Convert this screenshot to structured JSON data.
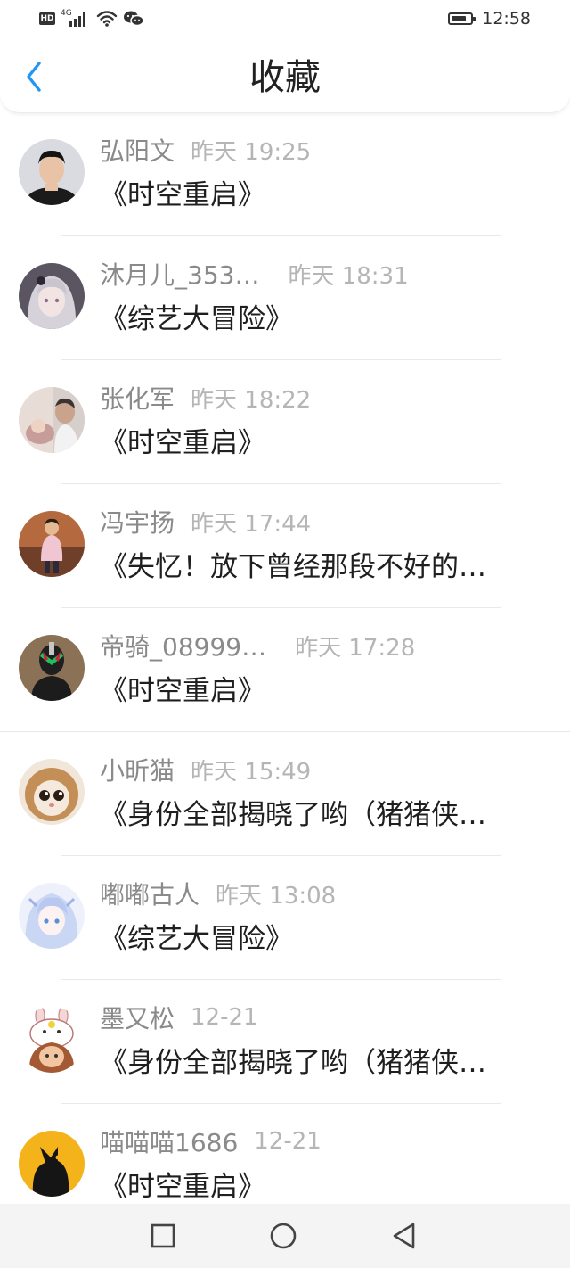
{
  "status_bar": {
    "hd_label": "HD",
    "network_label": "4G",
    "time": "12:58",
    "battery_level": 0.8,
    "icons": [
      "hd-icon",
      "signal-icon",
      "wifi-icon",
      "wechat-icon",
      "battery-icon"
    ]
  },
  "header": {
    "title": "收藏",
    "back_icon": "chevron-left-icon",
    "accent_color": "#2196f3"
  },
  "items": [
    {
      "name": "弘阳文",
      "time": "昨天 19:25",
      "title": "《时空重启》"
    },
    {
      "name": "沐月儿_353…",
      "time": "昨天 18:31",
      "title": "《综艺大冒险》"
    },
    {
      "name": "张化军",
      "time": "昨天 18:22",
      "title": "《时空重启》"
    },
    {
      "name": "冯宇扬",
      "time": "昨天 17:44",
      "title": "《失忆！放下曾经那段不好的…"
    },
    {
      "name": "帝骑_08999…",
      "time": "昨天 17:28",
      "title": "《时空重启》"
    },
    {
      "name": "小昕猫",
      "time": "昨天 15:49",
      "title": "《身份全部揭晓了哟（猪猪侠…"
    },
    {
      "name": "嘟嘟古人",
      "time": "昨天 13:08",
      "title": "《综艺大冒险》"
    },
    {
      "name": "墨又松",
      "time": "12-21",
      "title": "《身份全部揭晓了哟（猪猪侠…"
    },
    {
      "name": "喵喵喵1686",
      "time": "12-21",
      "title": "《时空重启》"
    }
  ],
  "nav_bar": {
    "icons": [
      "square-recent-icon",
      "circle-home-icon",
      "triangle-back-icon"
    ]
  },
  "colors": {
    "name_gray": "#8a8a8a",
    "time_gray": "#b5b5b5",
    "title_dark": "#1f1f1f",
    "navbar_bg": "#f4f4f4"
  }
}
